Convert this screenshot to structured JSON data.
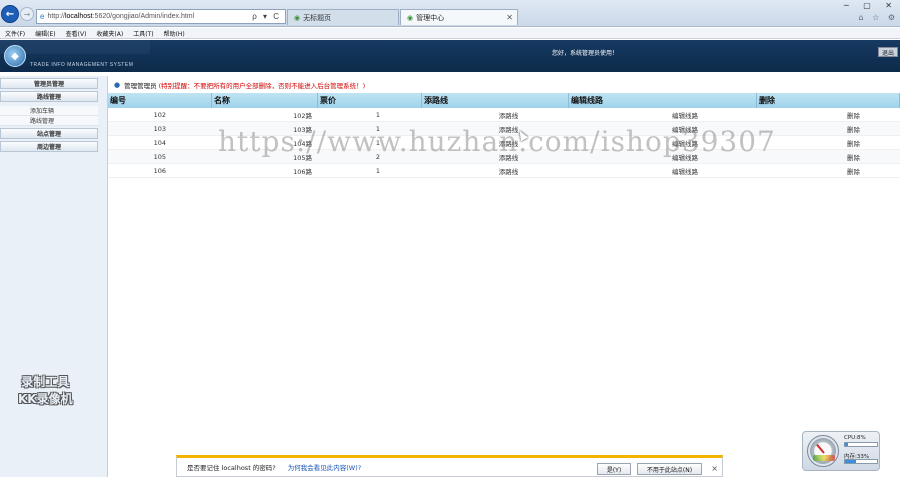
{
  "browser": {
    "address_prefix": "http://",
    "address_host": "localhost",
    "address_rest": ":5620/gongjiao/Admin/index.html",
    "address_tools": "ρ ▾ C",
    "tabs": [
      {
        "label": "无标题页"
      },
      {
        "label": "管理中心"
      }
    ],
    "window_controls": "─ ▢ ✕",
    "toolbar_icons": "⌂ ☆ ⚙",
    "menu": [
      "文件(F)",
      "编辑(E)",
      "查看(V)",
      "收藏夹(A)",
      "工具(T)",
      "帮助(H)"
    ]
  },
  "header": {
    "subtitle": "TRADE INFO MANAGEMENT SYSTEM",
    "welcome": "您好，系统管理员使用！",
    "logout": "退出"
  },
  "sidebar": {
    "sections": [
      {
        "title": "管理员管理",
        "items": []
      },
      {
        "title": "路线管理",
        "items": [
          "添加车辆",
          "路线管理"
        ]
      },
      {
        "title": "站点管理",
        "items": []
      },
      {
        "title": "周边管理",
        "items": []
      }
    ]
  },
  "watermark_kk": {
    "line1": "录制工具",
    "line2": "KK录像机"
  },
  "main": {
    "crumb_user": "管理管理员",
    "crumb_warning": "(特别提醒：不要把所有的用户全部删除，否则不能进入后台管理系统！)",
    "columns": [
      "编号",
      "名称",
      "票价",
      "添路线",
      "编辑线路",
      "删除"
    ],
    "rows": [
      {
        "id": "102",
        "name": "102路",
        "price": "1",
        "add": "添路线",
        "edit": "编辑线路",
        "del": "删除"
      },
      {
        "id": "103",
        "name": "103路",
        "price": "1",
        "add": "添路线",
        "edit": "编辑线路",
        "del": "删除"
      },
      {
        "id": "104",
        "name": "104路",
        "price": "1",
        "add": "添路线",
        "edit": "编辑线路",
        "del": "删除"
      },
      {
        "id": "105",
        "name": "105路",
        "price": "2",
        "add": "添路线",
        "edit": "编辑线路",
        "del": "删除"
      },
      {
        "id": "106",
        "name": "106路",
        "price": "1",
        "add": "添路线",
        "edit": "编辑线路",
        "del": "删除"
      }
    ]
  },
  "overlay_watermark": "https://www.huzhan.com/ishop39307",
  "notification": {
    "question": "是否要记住 localhost 的密码?",
    "help": "为何我会看见此内容(W)?",
    "yes": "是(Y)",
    "no": "不用于此站点(N)",
    "close": "×"
  },
  "cpu_widget": {
    "cpu_label": "CPU:8%",
    "cpu_fraction": 0.08,
    "mem_label": "内存:33%",
    "mem_fraction": 0.33
  }
}
